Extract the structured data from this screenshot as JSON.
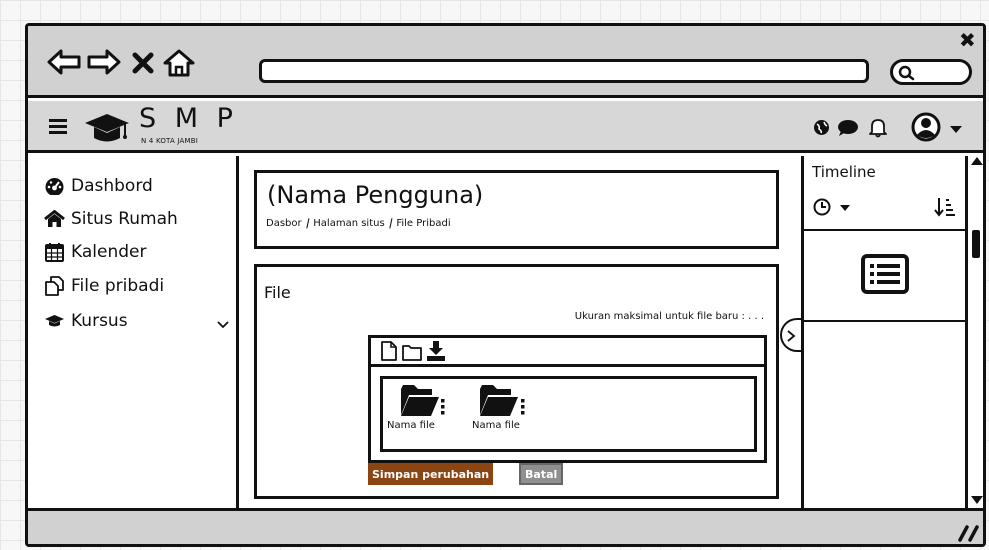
{
  "app": {
    "logo_main": "S M P",
    "logo_sub": "N 4 KOTA JAMBI"
  },
  "sidebar": {
    "items": [
      {
        "label": "Dashbord",
        "icon": "dashboard-icon"
      },
      {
        "label": "Situs Rumah",
        "icon": "home-icon"
      },
      {
        "label": "Kalender",
        "icon": "calendar-icon"
      },
      {
        "label": "File pribadi",
        "icon": "files-icon"
      },
      {
        "label": "Kursus",
        "icon": "graduation-cap-icon",
        "has_dropdown": true
      }
    ]
  },
  "page": {
    "title": "(Nama Pengguna)",
    "breadcrumb": [
      "Dasbor",
      "Halaman situs",
      "File Pribadi"
    ]
  },
  "files": {
    "heading": "File",
    "max_size_text": "Ukuran maksimal untuk file baru : . . .",
    "items": [
      {
        "name": "Nama file",
        "icon": "folder-open-icon"
      },
      {
        "name": "Nama file",
        "icon": "folder-open-icon"
      }
    ],
    "save_label": "Simpan perubahan",
    "cancel_label": "Batal"
  },
  "timeline": {
    "title": "Timeline"
  },
  "colors": {
    "save_button": "#8b4513",
    "cancel_button": "#8f8f8f",
    "chrome": "#d1d1d1",
    "border": "#111111"
  }
}
